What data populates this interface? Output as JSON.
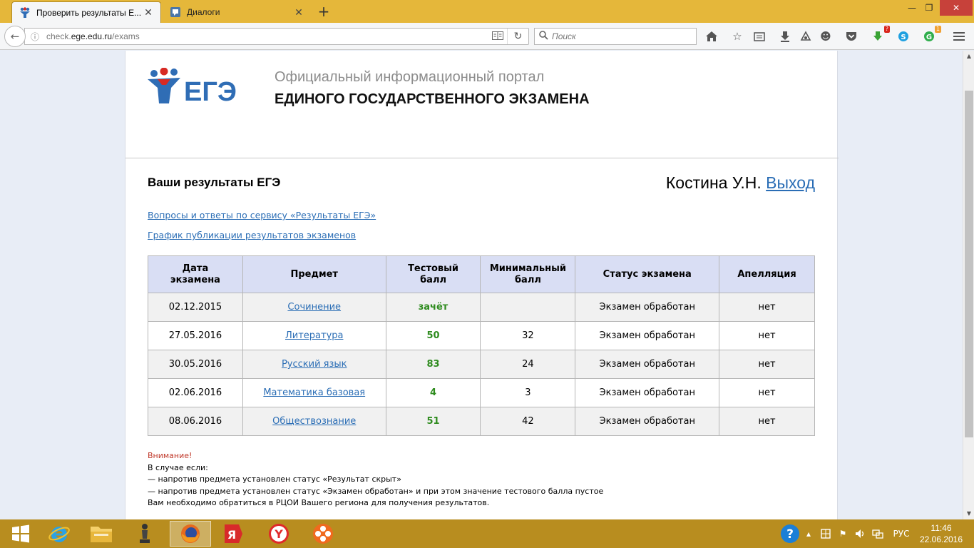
{
  "browser": {
    "tabs": [
      {
        "label": "Проверить результаты Е...",
        "active": true
      },
      {
        "label": "Диалоги",
        "active": false
      }
    ],
    "url": {
      "prefix": "check.",
      "domain": "ege.edu.ru",
      "path": "/exams"
    },
    "search_placeholder": "Поиск",
    "badges": {
      "download": "?",
      "ext": "1"
    }
  },
  "header": {
    "logo_text": "ЕГЭ",
    "portal_line1": "Официальный информационный портал",
    "portal_line2": "ЕДИНОГО ГОСУДАРСТВЕННОГО ЭКЗАМЕНА"
  },
  "main": {
    "title": "Ваши результаты ЕГЭ",
    "user_name": "Костина У.Н.",
    "logout_label": "Выход",
    "link_faq": "Вопросы и ответы по сервису «Результаты ЕГЭ»",
    "link_schedule": "График публикации результатов экзаменов",
    "table": {
      "headers": {
        "date": [
          "Дата",
          "экзамена"
        ],
        "subject": "Предмет",
        "score": [
          "Тестовый",
          "балл"
        ],
        "min_score": [
          "Минимальный",
          "балл"
        ],
        "status": "Статус экзамена",
        "appeal": "Апелляция"
      },
      "rows": [
        {
          "date": "02.12.2015",
          "subject": "Сочинение",
          "score": "зачёт",
          "min": "",
          "status": "Экзамен обработан",
          "appeal": "нет"
        },
        {
          "date": "27.05.2016",
          "subject": "Литература",
          "score": "50",
          "min": "32",
          "status": "Экзамен обработан",
          "appeal": "нет"
        },
        {
          "date": "30.05.2016",
          "subject": "Русский язык",
          "score": "83",
          "min": "24",
          "status": "Экзамен обработан",
          "appeal": "нет"
        },
        {
          "date": "02.06.2016",
          "subject": "Математика базовая",
          "score": "4",
          "min": "3",
          "status": "Экзамен обработан",
          "appeal": "нет"
        },
        {
          "date": "08.06.2016",
          "subject": "Обществознание",
          "score": "51",
          "min": "42",
          "status": "Экзамен обработан",
          "appeal": "нет"
        }
      ]
    },
    "notice": {
      "warning": "Внимание!",
      "lines": [
        "В случае если:",
        "— напротив предмета установлен статус «Результат скрыт»",
        "— напротив предмета установлен статус «Экзамен обработан» и при этом значение тестового балла пустое",
        "Вам необходимо обратиться в РЦОИ Вашего региона для получения результатов."
      ]
    }
  },
  "taskbar": {
    "language": "РУС",
    "time": "11:46",
    "date": "22.06.2016"
  },
  "colors": {
    "tabbar": "#e5b73a",
    "taskbar": "#b88d1f",
    "link": "#2a6db5",
    "score_green": "#2e8b1e",
    "table_header": "#d9def4",
    "warning_red": "#c0392b"
  }
}
